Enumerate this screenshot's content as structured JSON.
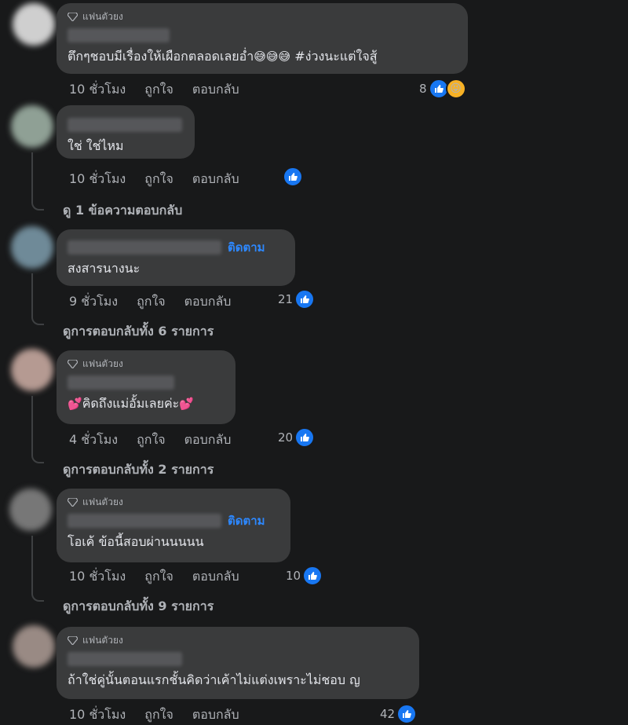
{
  "labels": {
    "like": "ถูกใจ",
    "reply": "ตอบกลับ",
    "fan_badge": "แฟนตัวยง",
    "follow": "ติดตาม"
  },
  "colors": {
    "background": "#18191a",
    "bubble": "#3a3b3c",
    "accent": "#2d88ff",
    "like": "#1877f2"
  },
  "comments": [
    {
      "time": "10 ชั่วโมง",
      "text_pre": "ตึกๆชอบมีเรื่องให้เผือกตลอดเลยอ่ำ",
      "emoji": "😅😅😅",
      "text_post": " #ง่วงนะแต่ใจสู้",
      "reaction_count": "8"
    },
    {
      "time": "10 ชั่วโมง",
      "text": "ใช่ ใช่ไหม",
      "reaction_count": "",
      "view_replies": "ดู 1 ข้อความตอบกลับ"
    },
    {
      "time": "9 ชั่วโมง",
      "text": "สงสารนางนะ",
      "reaction_count": "21",
      "view_replies": "ดูการตอบกลับทั้ง 6 รายการ"
    },
    {
      "time": "4 ชั่วโมง",
      "emoji_pre": "💕",
      "text": "คิดถึงแม่อั้มเลยค่ะ",
      "emoji_post": "💕",
      "reaction_count": "20",
      "view_replies": "ดูการตอบกลับทั้ง 2 รายการ"
    },
    {
      "time": "10 ชั่วโมง",
      "text": "โอเค้ ข้อนี้สอบผ่านนนนน",
      "reaction_count": "10",
      "view_replies": "ดูการตอบกลับทั้ง 9 รายการ"
    },
    {
      "time": "10 ชั่วโมง",
      "text": "ถ้าใช่คู่นั้นตอนแรกชั้นคิดว่าเค้าไม่แต่งเพราะไม่ชอบ ญ",
      "reaction_count": "42"
    }
  ]
}
